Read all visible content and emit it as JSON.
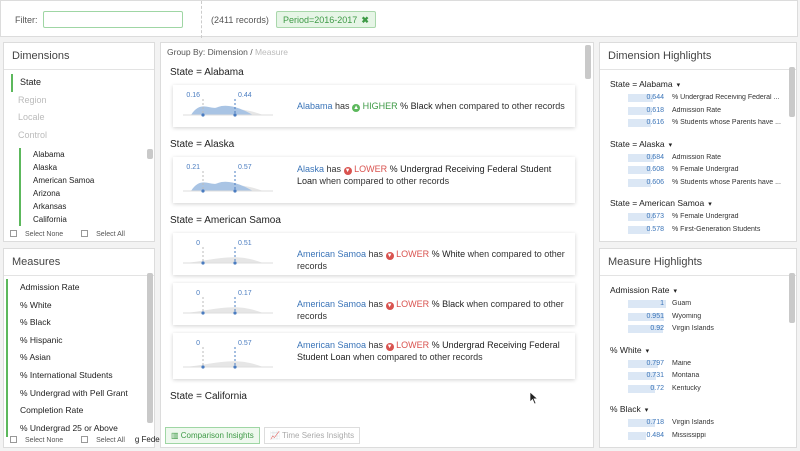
{
  "topbar": {
    "filter_label": "Filter:",
    "filter_value": "",
    "records": "(2411 records)",
    "period_chip": "Period=2016-2017",
    "chip_close": "✖"
  },
  "dimensions": {
    "title": "Dimensions",
    "items": [
      {
        "label": "State",
        "state": "active"
      },
      {
        "label": "Region",
        "state": "muted"
      },
      {
        "label": "Locale",
        "state": "muted"
      },
      {
        "label": "Control",
        "state": "muted"
      }
    ],
    "states": [
      "Alabama",
      "Alaska",
      "American Samoa",
      "Arizona",
      "Arkansas",
      "California"
    ],
    "select_none": "Select None",
    "select_all": "Select All"
  },
  "measures": {
    "title": "Measures",
    "items": [
      "Admission Rate",
      "% White",
      "% Black",
      "% Hispanic",
      "% Asian",
      "% International Students",
      "% Undergrad with Pell Grant",
      "Completion Rate",
      "% Undergrad 25 or Above"
    ],
    "select_none": "Select None",
    "select_all": "Select All",
    "overflow_text": "g Feder..."
  },
  "center": {
    "groupby_label": "Group By:",
    "groupby_dimension": "Dimension",
    "groupby_sep": "/",
    "groupby_measure": "Measure",
    "sections": [
      {
        "title": "State = Alabama",
        "cards": [
          {
            "val_left": "0.16",
            "val_right": "0.44",
            "state_name": "Alabama",
            "has": "has",
            "dir": "HIGHER",
            "metric": "% Black",
            "rest": "when compared to other records"
          }
        ]
      },
      {
        "title": "State = Alaska",
        "cards": [
          {
            "val_left": "0.21",
            "val_right": "0.57",
            "state_name": "Alaska",
            "has": "has",
            "dir": "LOWER",
            "metric": "% Undergrad Receiving Federal Student Loan",
            "rest": "when compared to other records"
          }
        ]
      },
      {
        "title": "State = American Samoa",
        "cards": [
          {
            "val_left": "0",
            "val_right": "0.51",
            "state_name": "American Samoa",
            "has": "has",
            "dir": "LOWER",
            "metric": "% White",
            "rest": "when compared to other records"
          },
          {
            "val_left": "0",
            "val_right": "0.17",
            "state_name": "American Samoa",
            "has": "has",
            "dir": "LOWER",
            "metric": "% Black",
            "rest": "when compared to other records"
          },
          {
            "val_left": "0",
            "val_right": "0.57",
            "state_name": "American Samoa",
            "has": "has",
            "dir": "LOWER",
            "metric": "% Undergrad Receiving Federal Student Loan",
            "rest": "when compared to other records"
          }
        ]
      },
      {
        "title": "State = California",
        "cards": []
      }
    ],
    "tabs": {
      "comparison": "Comparison Insights",
      "timeseries": "Time Series Insights"
    }
  },
  "dimension_highlights": {
    "title": "Dimension Highlights",
    "groups": [
      {
        "head": "State = Alabama",
        "rows": [
          {
            "value": "0.644",
            "label": "% Undergrad Receiving Federal ...",
            "frac": 0.644
          },
          {
            "value": "0.618",
            "label": "Admission Rate",
            "frac": 0.618
          },
          {
            "value": "0.616",
            "label": "% Students whose Parents have ...",
            "frac": 0.616
          }
        ]
      },
      {
        "head": "State = Alaska",
        "rows": [
          {
            "value": "0.684",
            "label": "Admission Rate",
            "frac": 0.684
          },
          {
            "value": "0.608",
            "label": "% Female Undergrad",
            "frac": 0.608
          },
          {
            "value": "0.606",
            "label": "% Students whose Parents have ...",
            "frac": 0.606
          }
        ]
      },
      {
        "head": "State = American Samoa",
        "rows": [
          {
            "value": "0.673",
            "label": "% Female Undergrad",
            "frac": 0.673
          },
          {
            "value": "0.578",
            "label": "% First-Generation Students",
            "frac": 0.578
          }
        ]
      }
    ]
  },
  "measure_highlights": {
    "title": "Measure Highlights",
    "groups": [
      {
        "head": "Admission Rate",
        "rows": [
          {
            "value": "1",
            "label": "Guam",
            "frac": 1
          },
          {
            "value": "0.951",
            "label": "Wyoming",
            "frac": 0.951
          },
          {
            "value": "0.92",
            "label": "Virgin Islands",
            "frac": 0.92
          }
        ]
      },
      {
        "head": "% White",
        "rows": [
          {
            "value": "0.797",
            "label": "Maine",
            "frac": 0.797
          },
          {
            "value": "0.731",
            "label": "Montana",
            "frac": 0.731
          },
          {
            "value": "0.72",
            "label": "Kentucky",
            "frac": 0.72
          }
        ]
      },
      {
        "head": "% Black",
        "rows": [
          {
            "value": "0.718",
            "label": "Virgin Islands",
            "frac": 0.718
          },
          {
            "value": "0.484",
            "label": "Mississippi",
            "frac": 0.484
          }
        ]
      }
    ]
  }
}
